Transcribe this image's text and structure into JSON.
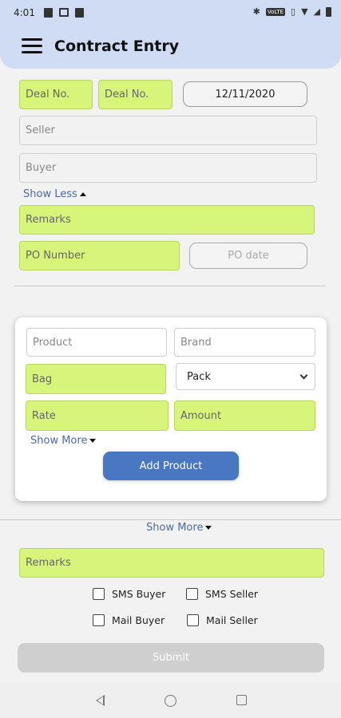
{
  "status_bar": {
    "time": "4:01",
    "volte": "VoLTE"
  },
  "header": {
    "title": "Contract Entry"
  },
  "deal": {
    "deal_no_1_placeholder": "Deal No.",
    "deal_no_2_placeholder": "Deal No.",
    "date_value": "12/11/2020"
  },
  "party": {
    "seller_placeholder": "Seller",
    "buyer_placeholder": "Buyer",
    "show_less_label": "Show Less",
    "remarks_placeholder": "Remarks",
    "po_number_placeholder": "PO Number",
    "po_date_placeholder": "PO date"
  },
  "product_card": {
    "product_placeholder": "Product",
    "brand_placeholder": "Brand",
    "bag_placeholder": "Bag",
    "pack_selected": "Pack",
    "rate_placeholder": "Rate",
    "amount_placeholder": "Amount",
    "show_more_label": "Show More",
    "add_product_label": "Add Product"
  },
  "footer_form": {
    "show_more_label": "Show More",
    "remarks_placeholder": "Remarks",
    "sms_buyer_label": "SMS Buyer",
    "sms_seller_label": "SMS Seller",
    "mail_buyer_label": "Mail Buyer",
    "mail_seller_label": "Mail Seller",
    "submit_label": "Submit"
  },
  "colors": {
    "header_bg": "#cfdcf3",
    "highlight_field": "#d7f57a",
    "primary_button": "#4a77c2",
    "link": "#4a6ba8",
    "disabled_button": "#cfcfcf"
  }
}
